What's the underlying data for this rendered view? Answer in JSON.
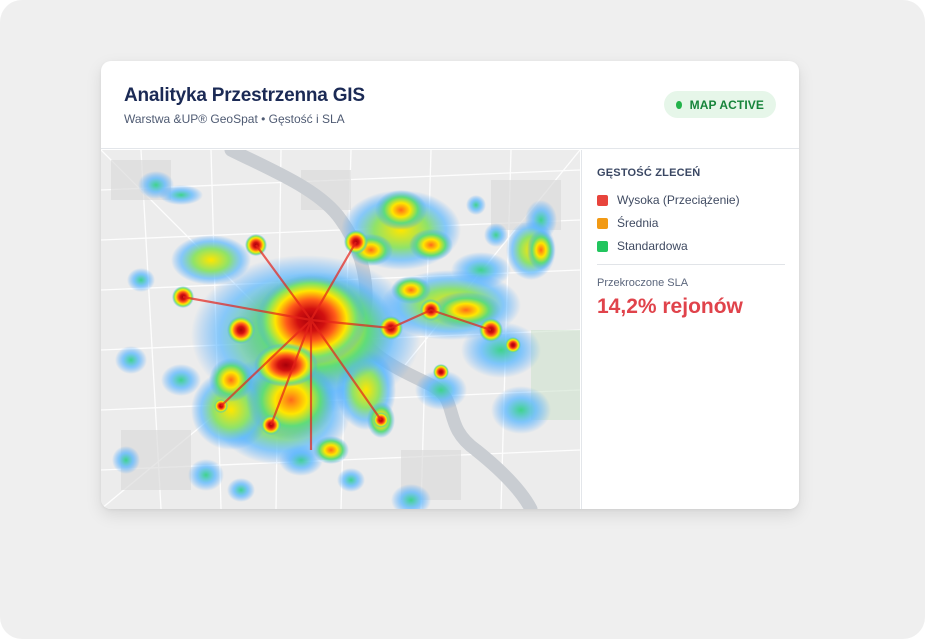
{
  "header": {
    "title": "Analityka Przestrzenna GIS",
    "subtitle": "Warstwa &UP® GeoSpat • Gęstość i SLA"
  },
  "status": {
    "label": "MAP ACTIVE",
    "color": "#22b34a"
  },
  "legend": {
    "title": "GĘSTOŚĆ ZLECEŃ",
    "items": [
      {
        "label": "Wysoka (Przeciążenie)",
        "color": "#e8443c"
      },
      {
        "label": "Średnia",
        "color": "#f29a14"
      },
      {
        "label": "Standardowa",
        "color": "#22c55e"
      }
    ]
  },
  "sla": {
    "label": "Przekroczone SLA",
    "value": "14,2% rejonów",
    "color": "#e0434b"
  },
  "map": {
    "layer": "heatmap",
    "river_color": "#c9cdd2",
    "heat_colors": [
      "#4aa3ff",
      "#3fd48a",
      "#ffe600",
      "#ff5a1a",
      "#c4000b"
    ]
  }
}
